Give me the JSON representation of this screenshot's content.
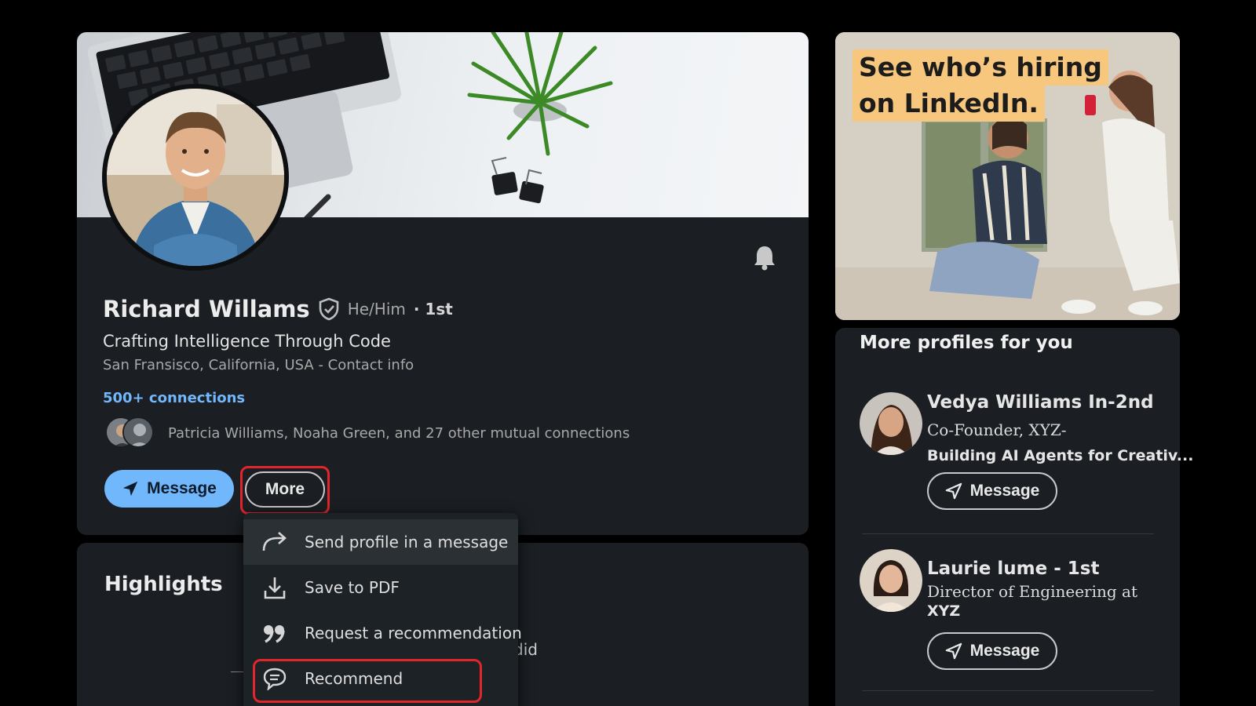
{
  "profile": {
    "name": "Richard Willams",
    "pronouns": "He/Him",
    "degree": "· 1st",
    "headline": "Crafting Intelligence Through Code",
    "location": "San Fransisco, California, USA - Contact info",
    "connections": "500+ connections",
    "mutual": "Patricia Williams, Noaha Green, and 27 other mutual connections",
    "message_label": "Message",
    "more_label": "More"
  },
  "dropdown": {
    "items": [
      {
        "label": "Send profile in a message",
        "icon": "share-arrow-icon"
      },
      {
        "label": "Save to PDF",
        "icon": "download-icon"
      },
      {
        "label": "Request a recommendation",
        "icon": "quote-icon"
      },
      {
        "label": "Recommend",
        "icon": "chat-bubble-icon"
      }
    ]
  },
  "highlights": {
    "title": "Highlights",
    "fragment": "did"
  },
  "ad": {
    "line1": "See who’s hiring",
    "line2": "on LinkedIn."
  },
  "more_profiles": {
    "title": "More profiles for you",
    "people": [
      {
        "name": "Vedya Williams In-2nd",
        "line1": "Co-Founder, XYZ-",
        "line2": "Building AI Agents for Creativ...",
        "button": "Message"
      },
      {
        "name": "Laurie lume - 1st",
        "line1": "Director of Engineering at",
        "line2": "XYZ",
        "button": "Message"
      }
    ]
  },
  "colors": {
    "accent": "#71b7fb",
    "card_bg": "#1b1f23",
    "highlight_outline": "#e0262a",
    "ad_text_bg": "#f8c77e"
  }
}
